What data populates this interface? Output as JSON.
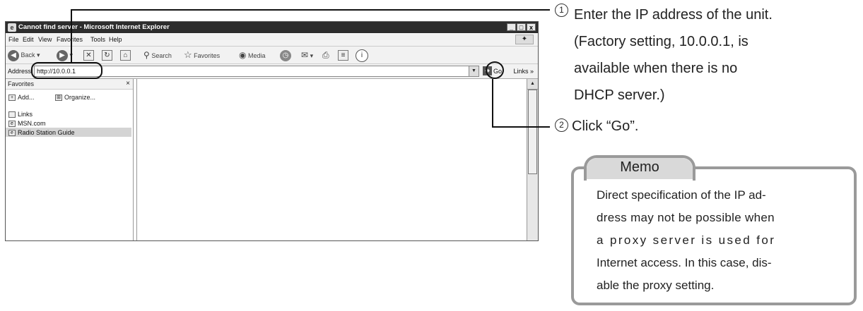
{
  "browser": {
    "title": "Cannot find server - Microsoft Internet Explorer",
    "window_buttons": [
      "_",
      "□",
      "x"
    ],
    "menu": [
      "File",
      "Edit",
      "View",
      "Favorites",
      "Tools",
      "Help"
    ],
    "toolbar": {
      "back": "Back",
      "search": "Search",
      "favorites": "Favorites",
      "media": "Media"
    },
    "address": {
      "label": "Address",
      "value": "http://10.0.0.1",
      "go": "Go",
      "links": "Links"
    },
    "favorites_pane": {
      "title": "Favorites",
      "close": "×",
      "add": "Add...",
      "organize": "Organize...",
      "items": [
        "Links",
        "MSN.com",
        "Radio Station Guide"
      ]
    }
  },
  "steps": [
    {
      "number": "1",
      "lines": [
        "Enter the IP address of the unit.",
        "(Factory setting, 10.0.0.1, is",
        "available when there is no",
        "DHCP server.)"
      ]
    },
    {
      "number": "2",
      "text": "Click “Go”."
    }
  ],
  "memo": {
    "title": "Memo",
    "lines": [
      "Direct specification of the IP ad-",
      "dress may not be possible when",
      "a proxy server is used for",
      "Internet access. In this case, dis-",
      "able the proxy setting."
    ]
  },
  "colors": {
    "titlebar": "#2d2d2d",
    "memo_border": "#9a9a9a",
    "memo_tab": "#d9d9d9"
  }
}
